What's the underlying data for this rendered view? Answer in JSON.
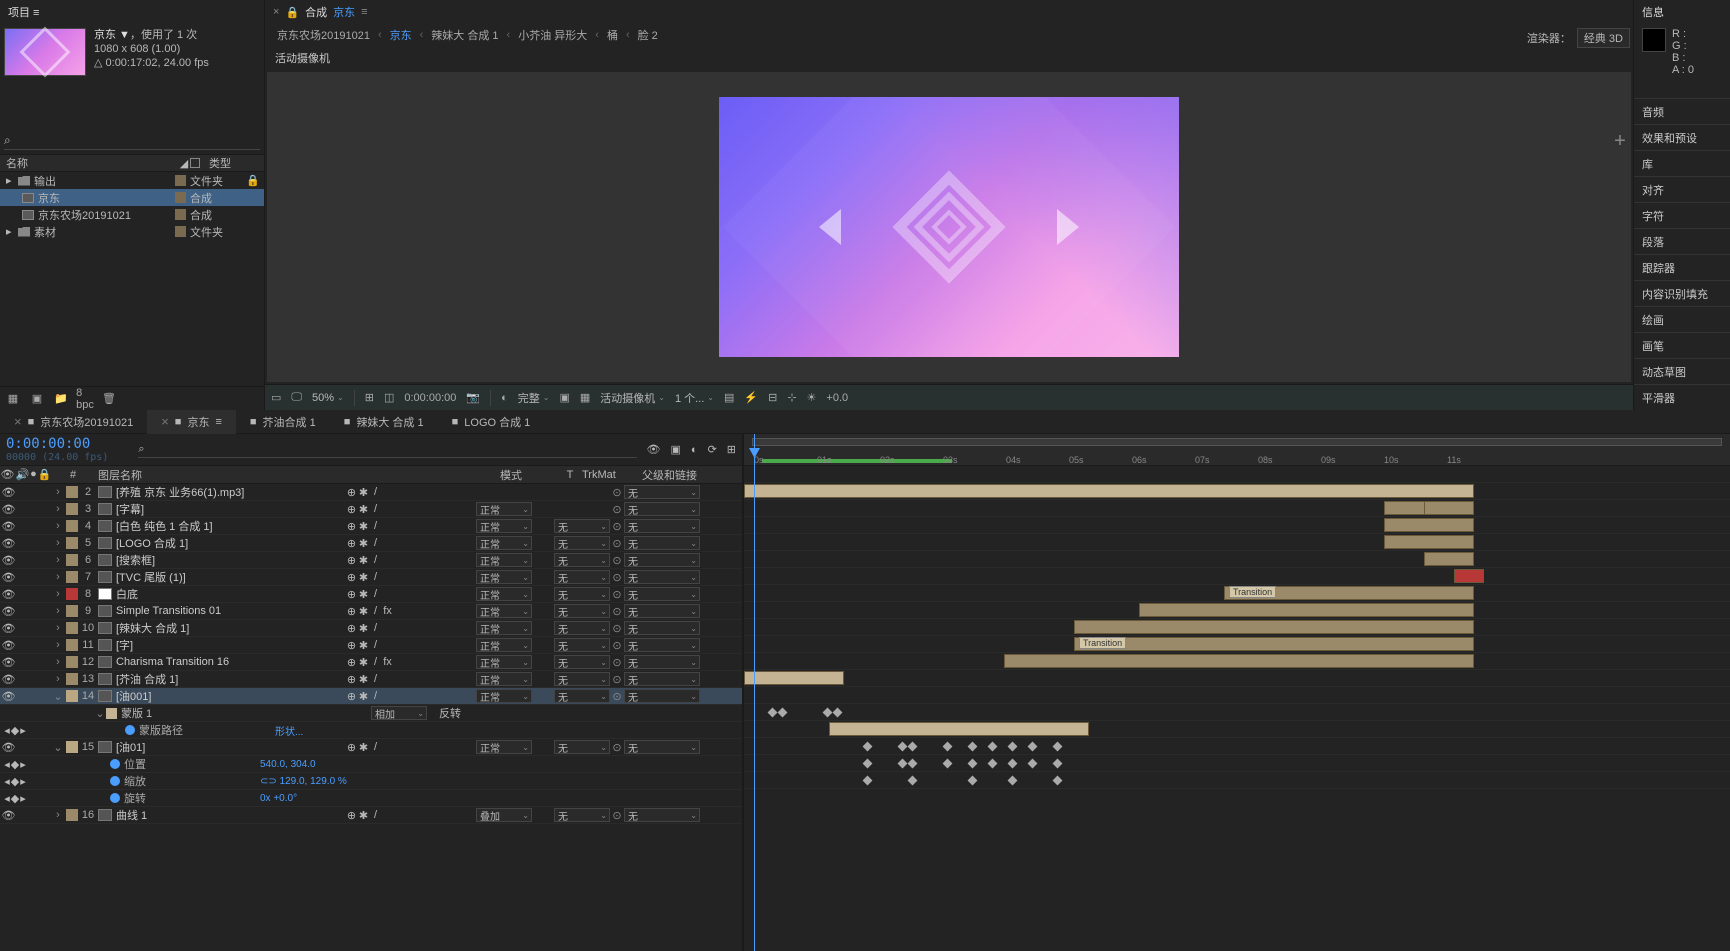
{
  "project": {
    "tab": "项目 ≡",
    "comp_name": "京东 ▼",
    "usage": "，使用了 1 次",
    "dims": "1080 x 608 (1.00)",
    "duration": "△ 0:00:17:02, 24.00 fps",
    "search_icon": "⌕",
    "col_name": "名称",
    "col_type": "类型",
    "items": [
      {
        "name": "输出",
        "type": "文件夹",
        "indent": 0,
        "kind": "folder"
      },
      {
        "name": "京东",
        "type": "合成",
        "indent": 1,
        "kind": "comp",
        "selected": true
      },
      {
        "name": "京东农场20191021",
        "type": "合成",
        "indent": 1,
        "kind": "comp"
      },
      {
        "name": "素材",
        "type": "文件夹",
        "indent": 0,
        "kind": "folder"
      }
    ],
    "bpc": "8 bpc"
  },
  "composition": {
    "tab_prefix": "× ",
    "tab_lock": "🔒",
    "tab_label": "合成",
    "tab_active": "京东",
    "breadcrumb": [
      {
        "t": "京东农场20191021",
        "a": false
      },
      {
        "t": "京东",
        "a": true
      },
      {
        "t": "辣妹大 合成 1",
        "a": false
      },
      {
        "t": "小芥油 异形大",
        "a": false
      },
      {
        "t": "桶",
        "a": false
      },
      {
        "t": "脸 2",
        "a": false
      }
    ],
    "camera_label": "活动摄像机",
    "renderer_label": "渲染器：",
    "renderer_value": "经典 3D",
    "footer": {
      "zoom": "50%",
      "time": "0:00:00:00",
      "res": "完整",
      "cam": "活动摄像机",
      "views": "1 个...",
      "exp": "+0.0"
    }
  },
  "info": {
    "title": "信息",
    "r": "R :",
    "g": "G :",
    "b": "B :",
    "a": "A : 0"
  },
  "panels": [
    "音频",
    "效果和预设",
    "库",
    "对齐",
    "字符",
    "段落",
    "跟踪器",
    "内容识别填充",
    "绘画",
    "画笔",
    "动态草图",
    "平滑器"
  ],
  "timeline": {
    "tabs": [
      {
        "label": "京东农场20191021",
        "active": false
      },
      {
        "label": "京东",
        "active": true
      },
      {
        "label": "芥油合成 1",
        "active": false
      },
      {
        "label": "辣妹大 合成 1",
        "active": false
      },
      {
        "label": "LOGO 合成 1",
        "active": false
      }
    ],
    "timecode": "0:00:00:00",
    "fps": "00000 (24.00 fps)",
    "header": {
      "name": "图层名称",
      "mode": "模式",
      "t": "T",
      "trk": "TrkMat",
      "parent": "父级和链接"
    },
    "ruler": [
      "0s",
      "01s",
      "02s",
      "03s",
      "04s",
      "05s",
      "06s",
      "07s",
      "08s",
      "09s",
      "10s",
      "11s"
    ],
    "layers": [
      {
        "n": 2,
        "name": "[养殖 京东 业务66(1).mp3]",
        "c": "c-tan",
        "mode": "",
        "trk": "",
        "parent": "无"
      },
      {
        "n": 3,
        "name": "[字幕]",
        "c": "c-tan",
        "mode": "正常",
        "trk": "",
        "parent": "无"
      },
      {
        "n": 4,
        "name": "[白色 纯色 1 合成 1]",
        "c": "c-tan",
        "mode": "正常",
        "trk": "无",
        "parent": "无"
      },
      {
        "n": 5,
        "name": "[LOGO 合成 1]",
        "c": "c-tan",
        "mode": "正常",
        "trk": "无",
        "parent": "无"
      },
      {
        "n": 6,
        "name": "[搜索框]",
        "c": "c-tan",
        "mode": "正常",
        "trk": "无",
        "parent": "无"
      },
      {
        "n": 7,
        "name": "[TVC 尾版 (1)]",
        "c": "c-tan",
        "mode": "正常",
        "trk": "无",
        "parent": "无"
      },
      {
        "n": 8,
        "name": "白底",
        "c": "c-red",
        "mode": "正常",
        "trk": "无",
        "parent": "无",
        "icon": "white"
      },
      {
        "n": 9,
        "name": "Simple Transitions 01",
        "c": "c-tan",
        "mode": "正常",
        "trk": "无",
        "parent": "无",
        "fx": true
      },
      {
        "n": 10,
        "name": "[辣妹大 合成 1]",
        "c": "c-tan",
        "mode": "正常",
        "trk": "无",
        "parent": "无"
      },
      {
        "n": 11,
        "name": "[字]",
        "c": "c-tan",
        "mode": "正常",
        "trk": "无",
        "parent": "无"
      },
      {
        "n": 12,
        "name": "Charisma Transition 16",
        "c": "c-tan",
        "mode": "正常",
        "trk": "无",
        "parent": "无",
        "fx": true
      },
      {
        "n": 13,
        "name": "[芥油 合成 1]",
        "c": "c-tan",
        "mode": "正常",
        "trk": "无",
        "parent": "无"
      },
      {
        "n": 14,
        "name": "[油001]",
        "c": "c-ltan",
        "mode": "正常",
        "trk": "无",
        "parent": "无",
        "sel": true,
        "exp": "v"
      }
    ],
    "mask": {
      "label": "蒙版 1",
      "mode": "相加",
      "inv": "反转",
      "path": "蒙版路径",
      "shape": "形状..."
    },
    "layer15": {
      "n": 15,
      "name": "[油01]",
      "c": "c-ltan",
      "mode": "正常",
      "trk": "无",
      "parent": "无",
      "exp": "v"
    },
    "props": [
      {
        "name": "位置",
        "val": "540.0, 304.0",
        "kf": true
      },
      {
        "name": "缩放",
        "val": "⊂⊃ 129.0, 129.0 %",
        "kf": true
      },
      {
        "name": "旋转",
        "val": "0x +0.0°",
        "kf": true
      }
    ],
    "layer16": {
      "n": 16,
      "name": "曲线 1",
      "mode": "叠加",
      "trk": "无",
      "parent": "无"
    },
    "markers": {
      "t1": "Transition",
      "t2": "Transition"
    }
  }
}
